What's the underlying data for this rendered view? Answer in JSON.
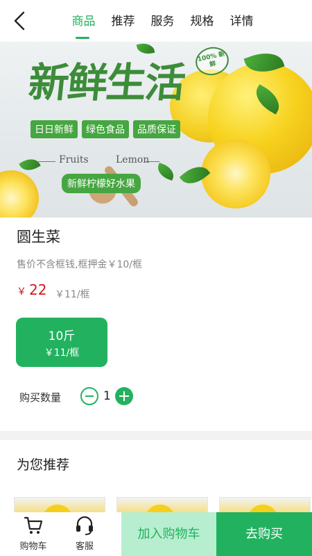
{
  "nav": {
    "back_icon": "chevron-left-icon",
    "tabs": [
      {
        "label": "商品",
        "active": true
      },
      {
        "label": "推荐",
        "active": false
      },
      {
        "label": "服务",
        "active": false
      },
      {
        "label": "规格",
        "active": false
      },
      {
        "label": "详情",
        "active": false
      }
    ]
  },
  "banner": {
    "title": "新鲜生活",
    "stamp": "100% 新鲜",
    "badges": [
      "日日新鲜",
      "绿色食品",
      "品质保证"
    ],
    "english_left": "Fruits",
    "english_right": "Lemon",
    "slogan": "新鲜柠檬好水果"
  },
  "product": {
    "name": "圆生菜",
    "note": "售价不含框钱,框押金￥10/框",
    "currency": "￥",
    "price": "22",
    "unit_price": "￥11/框",
    "spec": {
      "weight": "10斤",
      "price": "￥11/框",
      "selected": true
    },
    "quantity_label": "购买数量",
    "quantity": "1"
  },
  "recommend": {
    "title": "为您推荐"
  },
  "bottom": {
    "cart_label": "购物车",
    "service_label": "客服",
    "add_to_cart": "加入购物车",
    "buy_now": "去购买"
  },
  "colors": {
    "accent": "#22b25f",
    "price": "#d0151b",
    "cart_button_bg": "#b8eed0"
  }
}
